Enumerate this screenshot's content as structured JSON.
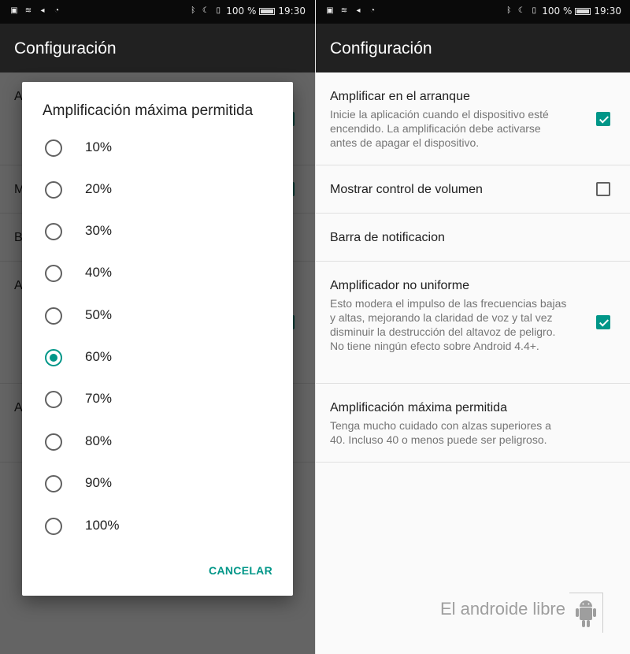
{
  "status_bar": {
    "battery_text": "100 %",
    "time": "19:30"
  },
  "left_screen": {
    "app_title": "Configuración",
    "background_initials": [
      "A",
      "M",
      "B",
      "A",
      "A"
    ],
    "dialog": {
      "title": "Amplificación máxima permitida",
      "options": [
        {
          "label": "10%",
          "selected": false
        },
        {
          "label": "20%",
          "selected": false
        },
        {
          "label": "30%",
          "selected": false
        },
        {
          "label": "40%",
          "selected": false
        },
        {
          "label": "50%",
          "selected": false
        },
        {
          "label": "60%",
          "selected": true
        },
        {
          "label": "70%",
          "selected": false
        },
        {
          "label": "80%",
          "selected": false
        },
        {
          "label": "90%",
          "selected": false
        },
        {
          "label": "100%",
          "selected": false
        }
      ],
      "cancel_label": "CANCELAR"
    }
  },
  "right_screen": {
    "app_title": "Configuración",
    "settings": [
      {
        "title": "Amplificar en el arranque",
        "subtitle": "Inicie la aplicación cuando el dispositivo esté encendido. La amplificación debe activarse antes de apagar el dispositivo.",
        "checkbox": true
      },
      {
        "title": "Mostrar control de volumen",
        "subtitle": "",
        "checkbox": false
      },
      {
        "title": "Barra de notificacion",
        "subtitle": "",
        "checkbox": null
      },
      {
        "title": "Amplificador no uniforme",
        "subtitle": "Esto modera el impulso de las frecuencias bajas y altas, mejorando la claridad de voz y tal vez disminuir la destrucción del altavoz de peligro. No tiene ningún efecto sobre Android 4.4+.",
        "checkbox": true
      },
      {
        "title": "Amplificación máxima permitida",
        "subtitle": "Tenga mucho cuidado con alzas superiores a 40. Incluso 40 o menos puede ser peligroso.",
        "checkbox": null
      }
    ],
    "watermark": "El androide libre"
  },
  "colors": {
    "accent": "#009688",
    "app_bar": "#212121",
    "status_bar": "#0a0a0a"
  },
  "icons": {
    "status_left": [
      "notification-icon",
      "wifi-icon",
      "volume-icon",
      "hotspot-icon"
    ],
    "status_right": [
      "bluetooth-icon",
      "moon-icon",
      "vibrate-icon",
      "battery-icon"
    ]
  }
}
